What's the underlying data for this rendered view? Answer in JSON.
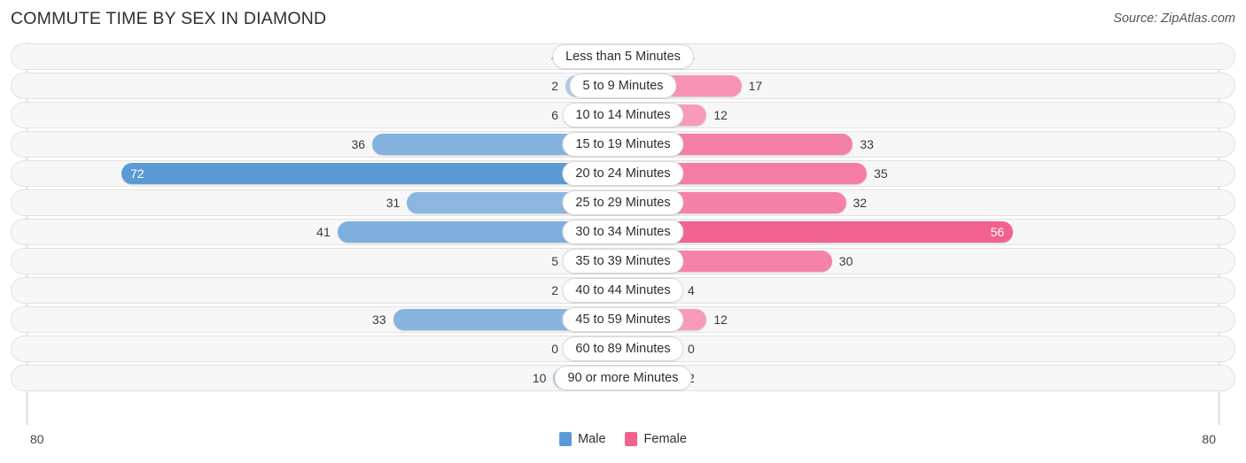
{
  "header": {
    "title": "COMMUTE TIME BY SEX IN DIAMOND",
    "source": "Source: ZipAtlas.com"
  },
  "axis": {
    "left_max": "80",
    "right_max": "80"
  },
  "legend": {
    "items": [
      {
        "label": "Male",
        "color": "#5b9bd5"
      },
      {
        "label": "Female",
        "color": "#f2628f"
      }
    ]
  },
  "colors": {
    "male_max": "#5b9bd5",
    "male_min": "#aecbe8",
    "female_max": "#f2628f",
    "female_min": "#f9aac6",
    "track_fill": "#f7f7f7",
    "track_border": "#e2e2e2",
    "axis_line": "#c9c9c9"
  },
  "chart_data": {
    "type": "bar",
    "title": "COMMUTE TIME BY SEX IN DIAMOND",
    "subtitle": "Source: ZipAtlas.com",
    "orientation": "horizontal-diverging",
    "xlabel": "",
    "ylabel": "",
    "xlim": [
      80,
      80
    ],
    "grid": false,
    "legend_position": "bottom-center",
    "categories": [
      "Less than 5 Minutes",
      "5 to 9 Minutes",
      "10 to 14 Minutes",
      "15 to 19 Minutes",
      "20 to 24 Minutes",
      "25 to 29 Minutes",
      "30 to 34 Minutes",
      "35 to 39 Minutes",
      "40 to 44 Minutes",
      "45 to 59 Minutes",
      "60 to 89 Minutes",
      "90 or more Minutes"
    ],
    "series": [
      {
        "name": "Male",
        "color": "#5b9bd5",
        "side": "left",
        "values": [
          4,
          2,
          6,
          36,
          72,
          31,
          41,
          5,
          2,
          33,
          0,
          10
        ]
      },
      {
        "name": "Female",
        "color": "#f2628f",
        "side": "right",
        "values": [
          4,
          17,
          12,
          33,
          35,
          32,
          56,
          30,
          4,
          12,
          0,
          2
        ]
      }
    ]
  }
}
